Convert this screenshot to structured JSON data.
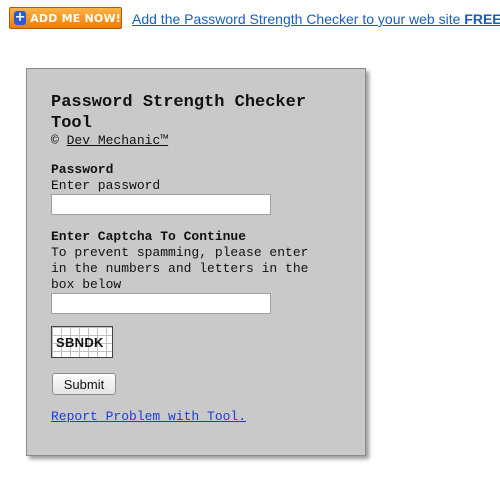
{
  "promo": {
    "add_button_label": "ADD ME NOW!",
    "link_text": "Add the Password Strength Checker to your web site ",
    "link_emphasis": "FREE!"
  },
  "tool": {
    "title": "Password Strength Checker Tool",
    "copyright_symbol": "©",
    "author": "Dev Mechanic™",
    "password_label": "Password",
    "password_help": "Enter password",
    "password_value": "",
    "captcha_label": "Enter Captcha To Continue",
    "captcha_help": "To prevent spamming, please enter in the numbers and letters in the box below",
    "captcha_value": "",
    "captcha_code": "SBNDK",
    "submit_label": "Submit",
    "report_link": "Report Problem with Tool."
  },
  "colors": {
    "panel_background": "#c9c9c9",
    "promo_link": "#1a5eb8",
    "report_link": "#1a3fd6",
    "add_button": "#f07c00"
  }
}
